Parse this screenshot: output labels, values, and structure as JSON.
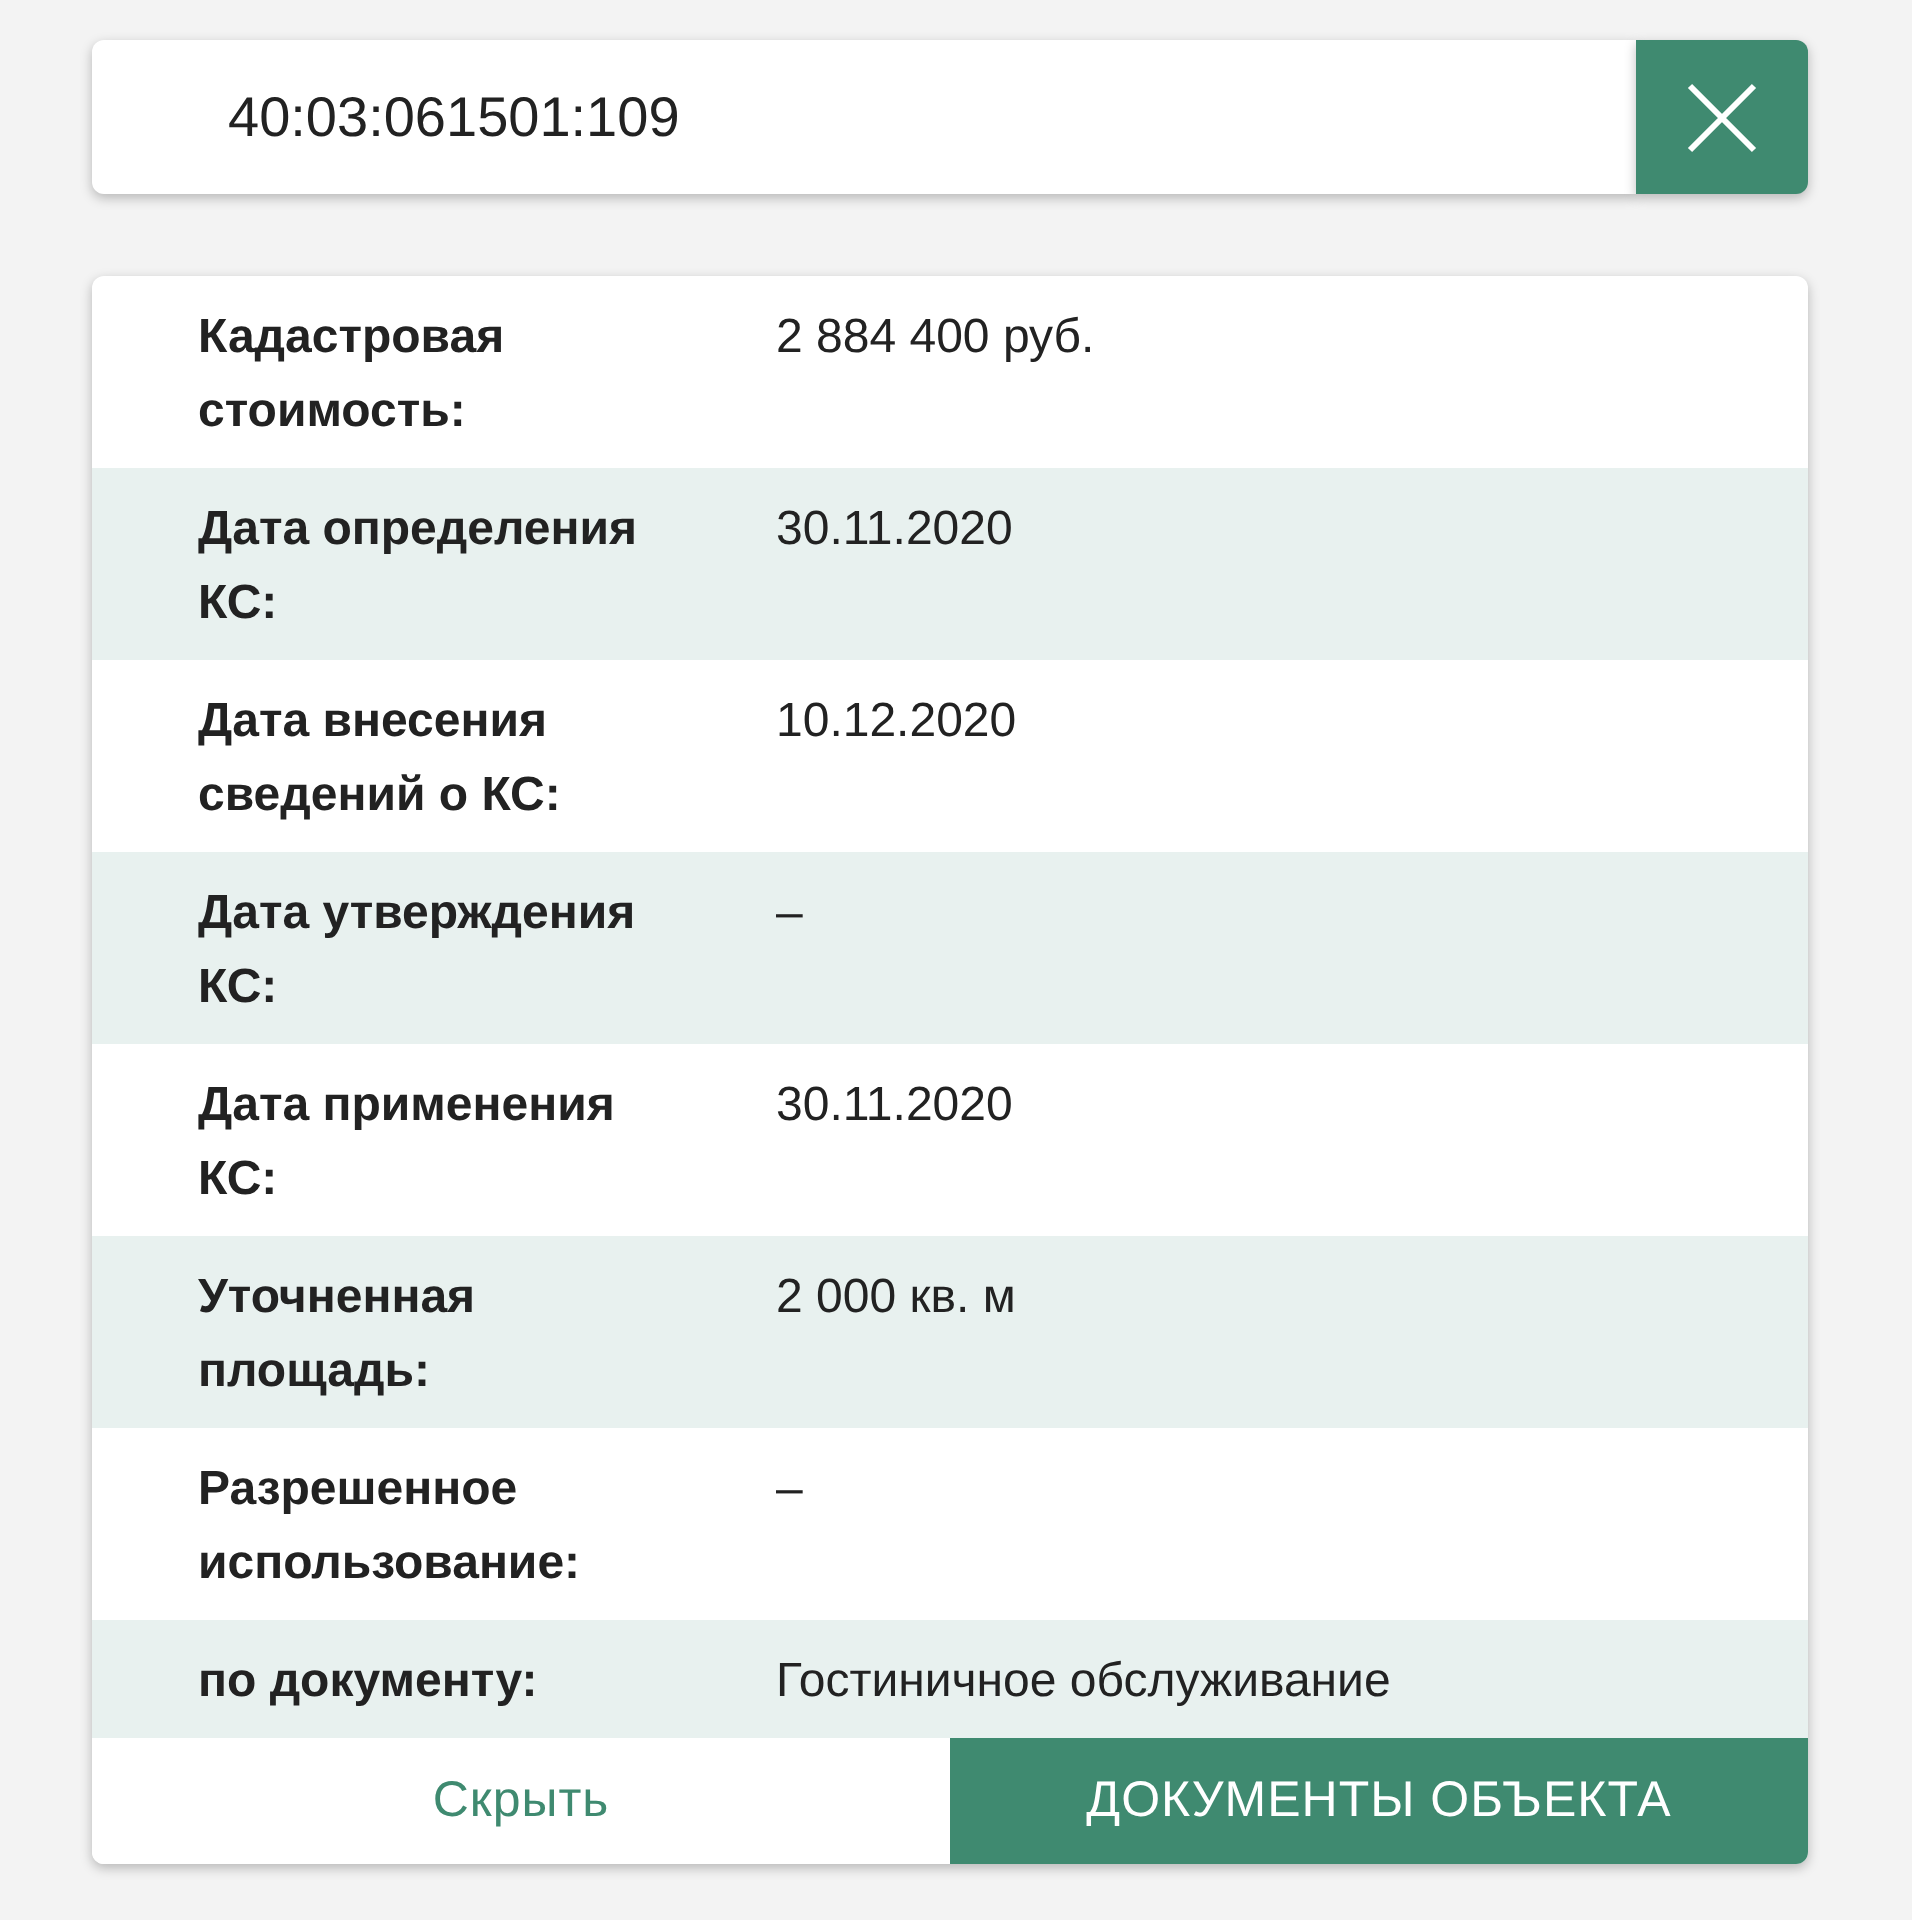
{
  "search": {
    "value": "40:03:061501:109"
  },
  "rows": [
    {
      "label": "Кадастровая стоимость:",
      "value": "2 884 400 руб."
    },
    {
      "label": "Дата определения КС:",
      "value": "30.11.2020"
    },
    {
      "label": "Дата внесения сведений о КС:",
      "value": "10.12.2020"
    },
    {
      "label": "Дата утверждения КС:",
      "value": "–"
    },
    {
      "label": "Дата применения КС:",
      "value": "30.11.2020"
    },
    {
      "label": "Уточненная площадь:",
      "value": "2 000 кв. м"
    },
    {
      "label": "Разрешенное использование:",
      "value": "–"
    },
    {
      "label": "по документу:",
      "value": "Гостиничное обслуживание"
    }
  ],
  "footer": {
    "hide_button": "Скрыть",
    "documents_button": "ДОКУМЕНТЫ ОБЪЕКТА"
  }
}
